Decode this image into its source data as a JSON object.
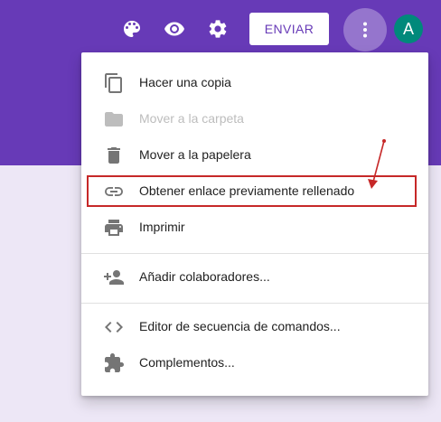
{
  "toolbar": {
    "palette_icon": "palette-icon",
    "preview_icon": "eye-icon",
    "settings_icon": "gear-icon",
    "send_label": "ENVIAR",
    "more_icon": "more-vert-icon",
    "avatar_letter": "A"
  },
  "colors": {
    "header": "#673ab7",
    "background": "#ede7f6",
    "accent": "#673ab7",
    "avatar": "#00897b",
    "annotation": "#c62828"
  },
  "menu": {
    "items": [
      {
        "label": "Hacer una copia",
        "icon": "copy-icon",
        "disabled": false
      },
      {
        "label": "Mover a la carpeta",
        "icon": "folder-icon",
        "disabled": true
      },
      {
        "label": "Mover a la papelera",
        "icon": "trash-icon",
        "disabled": false
      },
      {
        "label": "Obtener enlace previamente rellenado",
        "icon": "link-icon",
        "disabled": false,
        "highlighted": true
      },
      {
        "label": "Imprimir",
        "icon": "print-icon",
        "disabled": false
      },
      {
        "label": "Añadir colaboradores...",
        "icon": "add-people-icon",
        "disabled": false
      },
      {
        "label": "Editor de secuencia de comandos...",
        "icon": "code-icon",
        "disabled": false
      },
      {
        "label": "Complementos...",
        "icon": "puzzle-icon",
        "disabled": false
      }
    ]
  }
}
